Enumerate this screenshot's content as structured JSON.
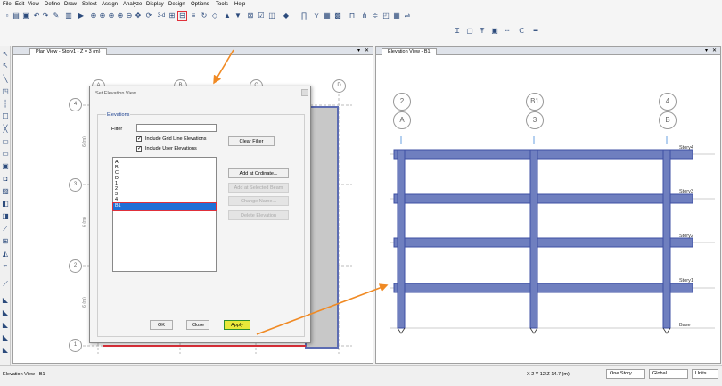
{
  "menu": [
    "File",
    "Edit",
    "View",
    "Define",
    "Draw",
    "Select",
    "Assign",
    "Analyze",
    "Display",
    "Design",
    "Options",
    "Tools",
    "Help"
  ],
  "toolbar": {
    "label_3d": "3-d"
  },
  "plan_view": {
    "tab_label": "Plan View - Story1 - Z = 3 (m)",
    "grid_top": [
      "A",
      "B",
      "C",
      "D"
    ],
    "grid_left": [
      "4",
      "3",
      "2",
      "1"
    ],
    "dims": [
      "6 (m)",
      "6 (m)",
      "6 (m)"
    ]
  },
  "elevation_view": {
    "tab_label": "Elevation View - B1",
    "grid_top_row1": [
      "2",
      "B1",
      "4"
    ],
    "grid_top_row2": [
      "A",
      "3",
      "B"
    ],
    "stories": [
      "Story4",
      "Story3",
      "Story2",
      "Story1",
      "Base"
    ]
  },
  "dialog": {
    "title": "Set Elevation View",
    "group_label": "Elevations",
    "filter_label": "Filter",
    "filter_value": "",
    "include_grid": "Include Grid Line Elevations",
    "include_user": "Include User Elevations",
    "items": [
      "A",
      "B",
      "C",
      "D",
      "1",
      "2",
      "3",
      "4",
      "B1"
    ],
    "selected": "B1",
    "buttons": {
      "clear_filter": "Clear Filter",
      "add_ordinate": "Add at Ordinate...",
      "add_beam": "Add at Selected Beam",
      "change_name": "Change Name...",
      "delete": "Delete Elevation",
      "ok": "OK",
      "close": "Close",
      "apply": "Apply"
    }
  },
  "status": {
    "left": "Elevation View - B1",
    "coords": "X 2  Y 12  Z 14.7 (m)",
    "story_mode": "One Story",
    "coord_sys": "Global",
    "units": "Units..."
  },
  "colors": {
    "frame": "#6f7fbf",
    "frame_dark": "#3d4fa3",
    "highlight_red": "#e0303a",
    "apply_yellow": "#e8e83a",
    "arrow": "#f08a24"
  }
}
